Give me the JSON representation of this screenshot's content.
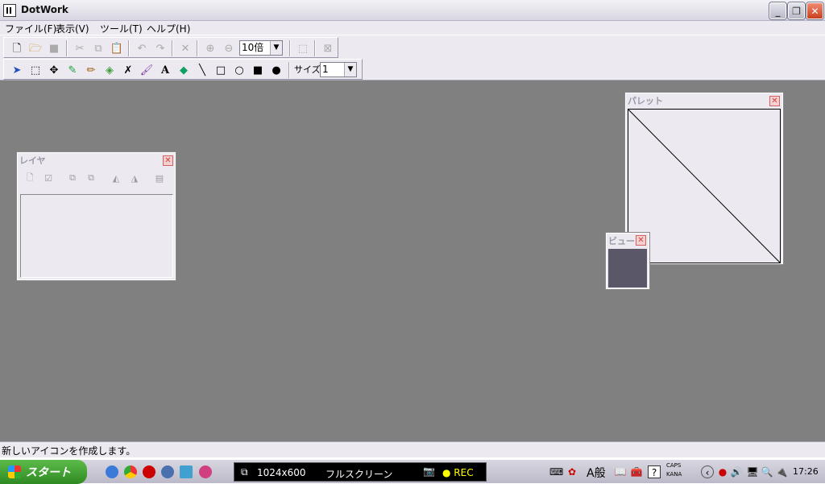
{
  "window": {
    "title": "DotWork",
    "minimize": "_",
    "maximize": "❐",
    "close": "✕"
  },
  "menu": {
    "items": [
      "ファイル(F)",
      "表示(V)",
      "ツール(T)",
      "ヘルプ(H)"
    ]
  },
  "toolbar1": {
    "zoom_value": "10倍"
  },
  "toolbar2": {
    "text_tool_label": "A",
    "size_label": "サイズ",
    "size_value": "1"
  },
  "layer_panel": {
    "title": "レイヤ"
  },
  "palette_panel": {
    "title": "パレット"
  },
  "view_panel": {
    "title": "ビュー"
  },
  "status": {
    "text": "新しいアイコンを作成します。"
  },
  "taskbar": {
    "start_label": "スタート",
    "task_resolution": "1024x600",
    "task_mode": "フルスクリーン",
    "task_rec": "● REC",
    "tray": {
      "ime": "A般",
      "caps": "CAPS",
      "kana": "KANA",
      "clock": "17:26"
    }
  }
}
